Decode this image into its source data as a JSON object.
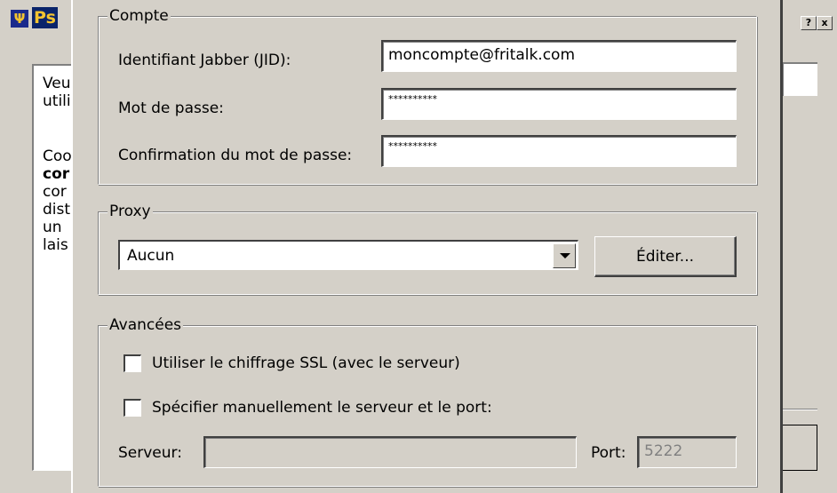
{
  "background_window": {
    "title": "Ps",
    "help_button": "?",
    "close_button": "x",
    "text_lines": [
      "Veu",
      "utili",
      "",
      "Coo",
      "cor",
      "cor",
      "dist",
      "un",
      "lais"
    ]
  },
  "account": {
    "legend": "Compte",
    "jid_label": "Identifiant Jabber (JID):",
    "jid_value": "moncompte@fritalk.com",
    "password_label": "Mot de passe:",
    "password_value": "**********",
    "confirm_label": "Confirmation du mot de passe:",
    "confirm_value": "**********"
  },
  "proxy": {
    "legend": "Proxy",
    "selected": "Aucun",
    "edit_button": "Éditer..."
  },
  "advanced": {
    "legend": "Avancées",
    "ssl_label": "Utiliser le chiffrage SSL (avec le serveur)",
    "ssl_checked": false,
    "manual_label": "Spécifier manuellement le serveur et le port:",
    "manual_checked": false,
    "server_label": "Serveur:",
    "server_value": "",
    "port_label": "Port:",
    "port_value": "5222"
  },
  "colors": {
    "face": "#d4d0c8",
    "title_active": "#0a246a",
    "title_text": "#f4c430",
    "disabled_text": "#808080"
  }
}
